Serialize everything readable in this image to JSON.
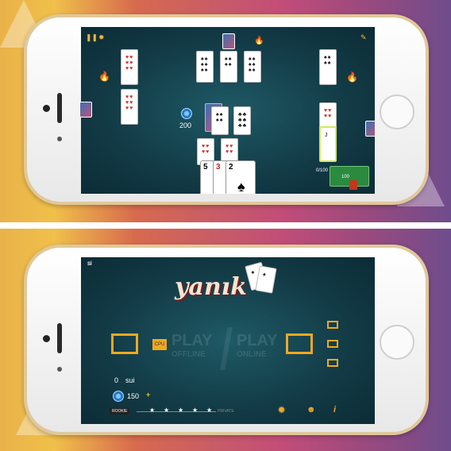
{
  "top_screen": {
    "score_left_top": "200",
    "right_score_label": "0/100",
    "scoreboard_value": "100",
    "pause_icon": "pause-icon",
    "settings_icon": "gear-icon",
    "hand_cards": [
      "5",
      "3",
      "2"
    ]
  },
  "bottom_screen": {
    "brand": "Sİ",
    "logo_text": "yanık",
    "cpu_label": "CPU",
    "play_offline": [
      "PLAY",
      "OFFLINE"
    ],
    "play_online": [
      "PLAY",
      "ONLINE"
    ],
    "user_name": "sui",
    "user_level_count": "0",
    "coin_count": "150",
    "plus": "+",
    "rank_start": "ROOKIE",
    "rank_end": "PRIVATE",
    "stars": [
      "★",
      "★",
      "★",
      "★",
      "★"
    ],
    "icons": {
      "settings": "gear-icon",
      "friends": "group-icon",
      "info": "i"
    }
  }
}
